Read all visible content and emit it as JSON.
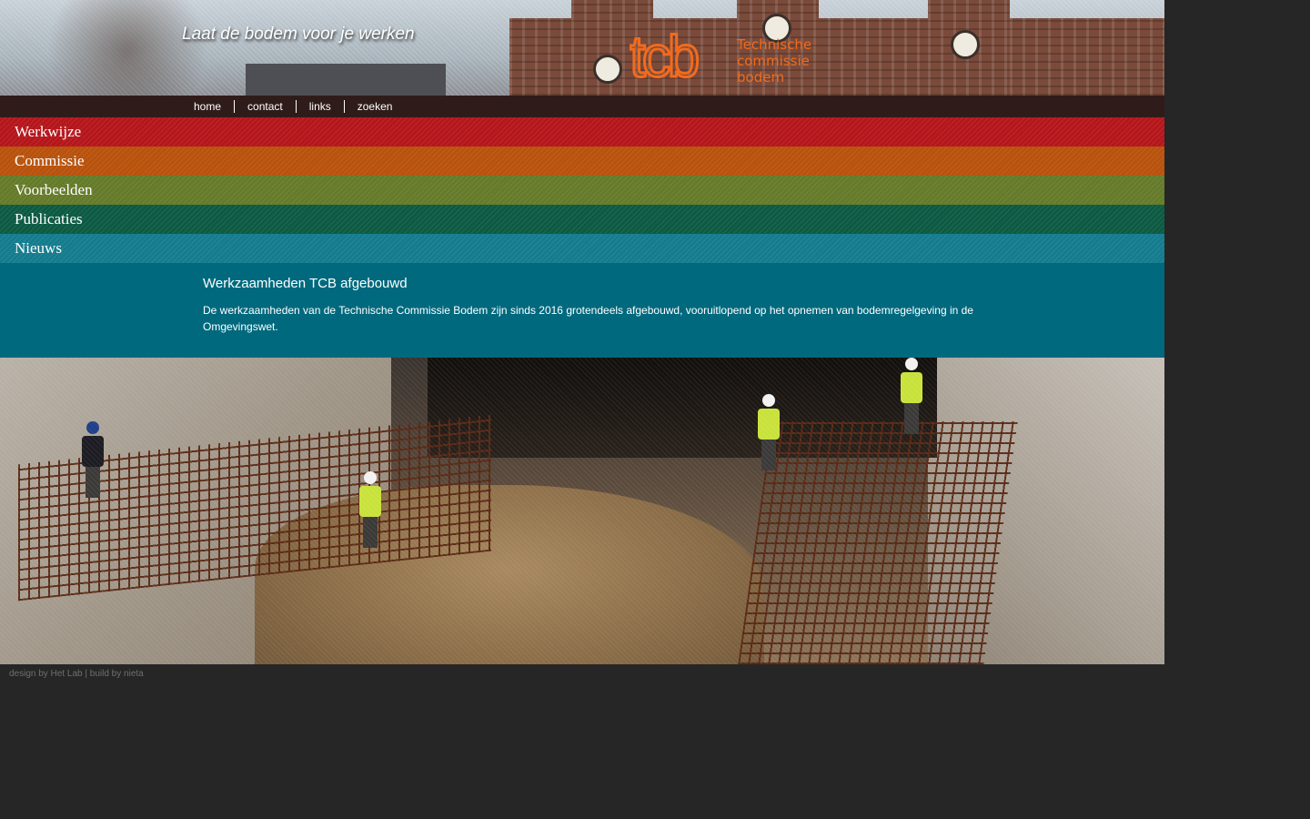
{
  "header": {
    "tagline": "Laat de bodem voor je werken",
    "logo": {
      "mark": "tcb",
      "line1": "Technische",
      "line2": "commissie",
      "line3": "bodem",
      "color": "#f26b1d"
    }
  },
  "topnav": {
    "items": [
      {
        "label": "home"
      },
      {
        "label": "contact"
      },
      {
        "label": "links"
      },
      {
        "label": "zoeken"
      }
    ]
  },
  "menu": {
    "items": [
      {
        "label": "Werkwijze",
        "color": "#b5161b"
      },
      {
        "label": "Commissie",
        "color": "#b8520c"
      },
      {
        "label": "Voorbeelden",
        "color": "#657b2a"
      },
      {
        "label": "Publicaties",
        "color": "#0d5a43"
      },
      {
        "label": "Nieuws",
        "color": "#147c8e"
      }
    ]
  },
  "news": {
    "background": "#00697e",
    "title": "Werkzaamheden TCB afgebouwd",
    "body": "De werkzaamheden van de Technische Commissie Bodem zijn sinds 2016 grotendeels afgebouwd, vooruitlopend op het opnemen van bodemregelgeving in de Omgevingswet."
  },
  "footer": {
    "prefix": "design by ",
    "designer": "Het Lab",
    "separator": " | build by ",
    "builder": "nieta"
  }
}
